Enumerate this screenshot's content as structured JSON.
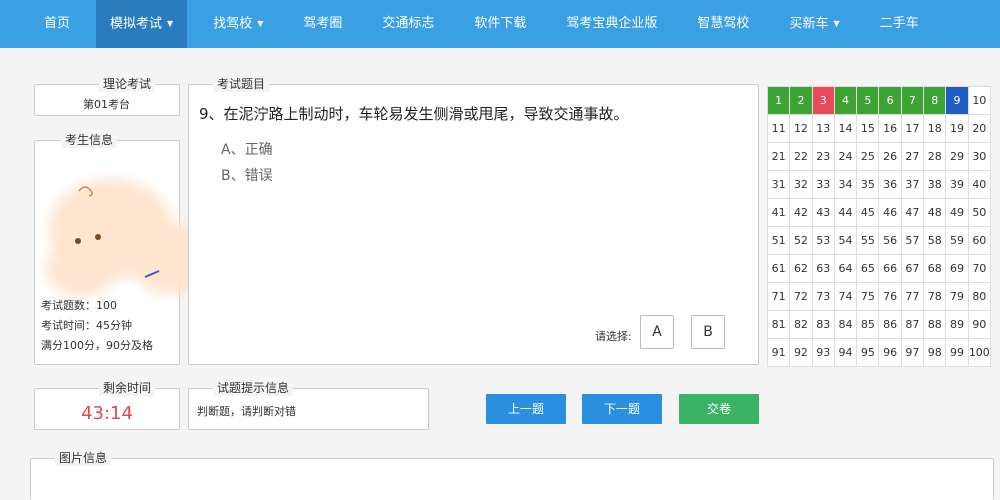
{
  "nav": {
    "items": [
      {
        "label": "首页",
        "caret": false
      },
      {
        "label": "模拟考试",
        "caret": true
      },
      {
        "label": "找驾校",
        "caret": true
      },
      {
        "label": "驾考圈",
        "caret": false
      },
      {
        "label": "交通标志",
        "caret": false
      },
      {
        "label": "软件下载",
        "caret": false
      },
      {
        "label": "驾考宝典企业版",
        "caret": false
      },
      {
        "label": "智慧驾校",
        "caret": false
      },
      {
        "label": "买新车",
        "caret": true
      },
      {
        "label": "二手车",
        "caret": false
      }
    ],
    "active_index": 1
  },
  "exam": {
    "legend": "理论考试",
    "station": "第01考台"
  },
  "examinee": {
    "legend": "考生信息",
    "count_label": "考试题数：100",
    "time_label": "考试时间：45分钟",
    "pass_label": "满分100分，90分及格"
  },
  "question": {
    "legend": "考试题目",
    "text": "9、在泥泞路上制动时，车轮易发生侧滑或甩尾，导致交通事故。",
    "options": [
      "A、正确",
      "B、错误"
    ],
    "choose_label": "请选择:",
    "answers": [
      "A",
      "B"
    ]
  },
  "grid": {
    "correct": [
      1,
      2,
      4,
      5,
      6,
      7,
      8
    ],
    "wrong": [
      3
    ],
    "current": 9,
    "total": 100
  },
  "timer": {
    "legend": "剩余时间",
    "value": "43:14"
  },
  "hint": {
    "legend": "试题提示信息",
    "text": "判断题，请判断对错"
  },
  "actions": {
    "prev": "上一题",
    "next": "下一题",
    "submit": "交卷"
  },
  "image_info": {
    "legend": "图片信息"
  },
  "colors": {
    "nav_bg": "#3b9fe3",
    "correct": "#3ea335",
    "wrong": "#e84a5a",
    "current": "#1e5ec4",
    "prev_btn": "#2b8fe0",
    "next_btn": "#2b8fe0",
    "submit_btn": "#3bb365",
    "timer": "#e04a4a"
  }
}
